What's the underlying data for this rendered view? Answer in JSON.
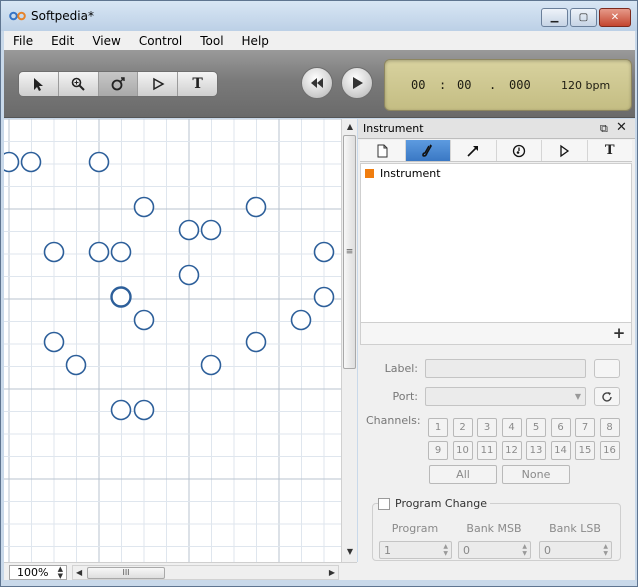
{
  "window": {
    "title": "Softpedia*",
    "min_glyph": "▁",
    "max_glyph": "▢",
    "close_glyph": "✕"
  },
  "menu": [
    "File",
    "Edit",
    "View",
    "Control",
    "Tool",
    "Help"
  ],
  "toolbar": {
    "tools": [
      {
        "name": "pointer",
        "icon": "arrow-pointer-icon"
      },
      {
        "name": "zoom",
        "icon": "magnifier-icon"
      },
      {
        "name": "node",
        "icon": "circle-node-icon"
      },
      {
        "name": "play-tool",
        "icon": "triangle-play-icon"
      },
      {
        "name": "text",
        "icon": "text-t-icon",
        "glyph": "T"
      }
    ],
    "active_tool": "node",
    "transport": {
      "rewind_icon": "rewind-icon",
      "play_icon": "play-icon"
    },
    "lcd": {
      "minutes": "00",
      "sep1": ":",
      "seconds": "00",
      "sep2": ".",
      "millis": "000",
      "bpm": "120 bpm"
    }
  },
  "canvas": {
    "grid_color": "#dfe6ee",
    "major_grid_color": "#b8c3cf",
    "node_color": "#2d5f9a"
  },
  "panel": {
    "title": "Instrument",
    "float_glyph": "⧉",
    "close_glyph": "✕",
    "tabs": [
      {
        "name": "document",
        "icon": "document-icon"
      },
      {
        "name": "instrument",
        "icon": "saxophone-icon"
      },
      {
        "name": "arrow",
        "icon": "diagonal-arrow-icon"
      },
      {
        "name": "clock",
        "icon": "clock-note-icon"
      },
      {
        "name": "play",
        "icon": "play-outline-icon"
      },
      {
        "name": "text",
        "icon": "text-t-icon",
        "glyph": "T"
      }
    ],
    "active_tab": "instrument",
    "instruments": [
      {
        "label": "Instrument",
        "color": "#f07d0e"
      }
    ],
    "add_glyph": "+",
    "form": {
      "label_label": "Label:",
      "port_label": "Port:",
      "channels_label": "Channels:",
      "channels": [
        "1",
        "2",
        "3",
        "4",
        "5",
        "6",
        "7",
        "8",
        "9",
        "10",
        "11",
        "12",
        "13",
        "14",
        "15",
        "16"
      ],
      "all_label": "All",
      "none_label": "None",
      "program_change_label": "Program Change",
      "program_label": "Program",
      "bank_msb_label": "Bank MSB",
      "bank_lsb_label": "Bank LSB",
      "program_value": "1",
      "bank_msb_value": "0",
      "bank_lsb_value": "0"
    }
  },
  "status": {
    "zoom": "100%",
    "hscroll_grip": "III"
  },
  "colors": {
    "accent": "#3a78c4",
    "lcd_bg": "#cfc993",
    "instrument_orange": "#f07d0e"
  }
}
